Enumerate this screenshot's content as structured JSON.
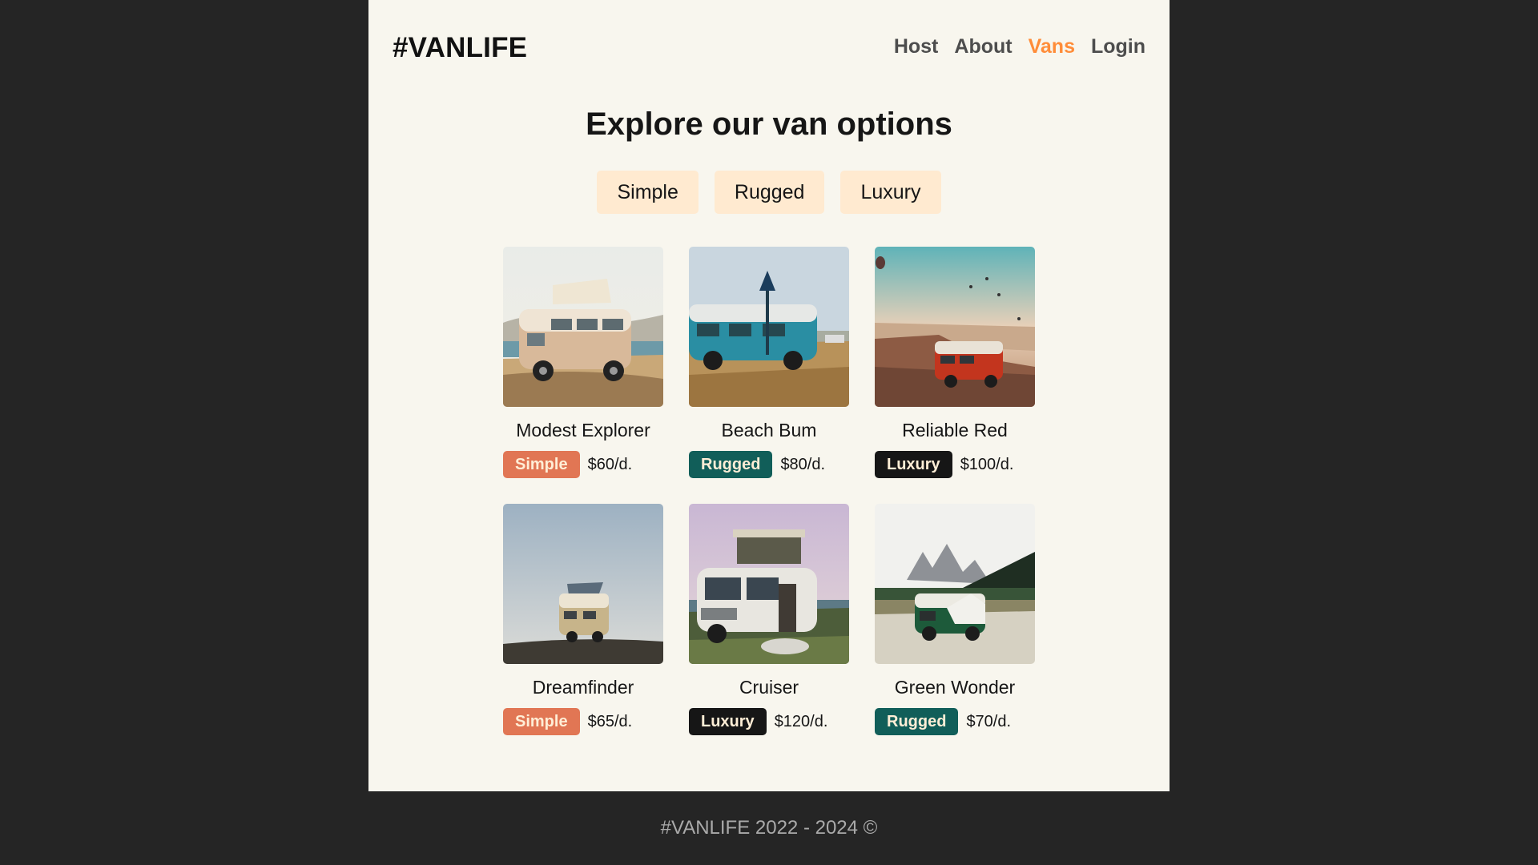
{
  "header": {
    "logo": "#VANLIFE",
    "nav": [
      {
        "label": "Host",
        "active": false
      },
      {
        "label": "About",
        "active": false
      },
      {
        "label": "Vans",
        "active": true
      },
      {
        "label": "Login",
        "active": false
      }
    ]
  },
  "main": {
    "title": "Explore our van options",
    "filters": [
      "Simple",
      "Rugged",
      "Luxury"
    ],
    "vans": [
      {
        "name": "Modest Explorer",
        "type": "Simple",
        "price": "$60/d.",
        "image": "beige-camper-van-photo"
      },
      {
        "name": "Beach Bum",
        "type": "Rugged",
        "price": "$80/d.",
        "image": "blue-camper-van-photo"
      },
      {
        "name": "Reliable Red",
        "type": "Luxury",
        "price": "$100/d.",
        "image": "red-van-canyon-photo"
      },
      {
        "name": "Dreamfinder",
        "type": "Simple",
        "price": "$65/d.",
        "image": "van-on-hill-photo"
      },
      {
        "name": "Cruiser",
        "type": "Luxury",
        "price": "$120/d.",
        "image": "white-van-rooftop-tent-photo"
      },
      {
        "name": "Green Wonder",
        "type": "Rugged",
        "price": "$70/d.",
        "image": "green-van-mountains-photo"
      }
    ]
  },
  "footer": {
    "text": "#VANLIFE 2022 - 2024 ©"
  },
  "colors": {
    "background": "#252525",
    "page": "#f8f6ee",
    "accent": "#ff8c38",
    "filter_bg": "#ffead0",
    "simple": "#e17654",
    "rugged": "#115e59",
    "luxury": "#161616"
  }
}
